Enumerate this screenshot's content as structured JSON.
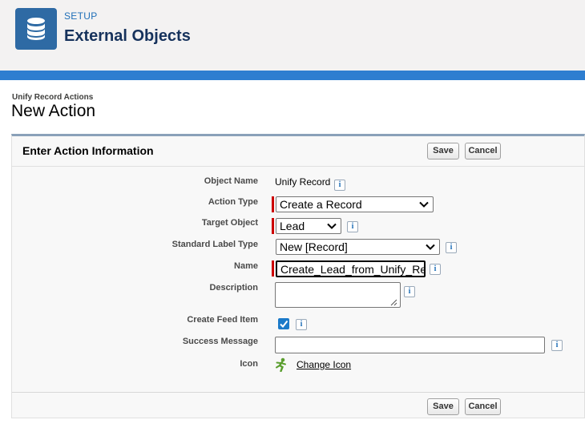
{
  "header": {
    "setup_label": "SETUP",
    "title": "External Objects",
    "icon": "database-icon"
  },
  "breadcrumb": "Unify Record Actions",
  "page_title": "New Action",
  "section": {
    "title": "Enter Action Information",
    "save_label": "Save",
    "cancel_label": "Cancel"
  },
  "fields": {
    "object_name": {
      "label": "Object Name",
      "value": "Unify Record"
    },
    "action_type": {
      "label": "Action Type",
      "value": "Create a Record"
    },
    "target_object": {
      "label": "Target Object",
      "value": "Lead"
    },
    "standard_label_type": {
      "label": "Standard Label Type",
      "value": "New [Record]"
    },
    "name": {
      "label": "Name",
      "value": "Create_Lead_from_Unify_Re"
    },
    "description": {
      "label": "Description",
      "value": ""
    },
    "create_feed_item": {
      "label": "Create Feed Item",
      "checked": true
    },
    "success_message": {
      "label": "Success Message",
      "value": ""
    },
    "icon": {
      "label": "Icon",
      "link": "Change Icon",
      "icon_name": "running-figure-icon"
    }
  },
  "info_glyph": "i",
  "colors": {
    "accent": "#2e6aa4",
    "required": "#cc0000",
    "checkbox": "#1b7ac9"
  }
}
